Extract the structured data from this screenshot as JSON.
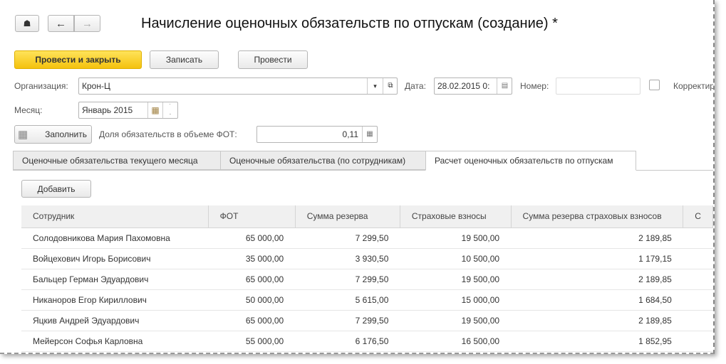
{
  "title": "Начисление оценочных обязательств по отпускам (создание) *",
  "toolbar": {
    "post_close": "Провести и закрыть",
    "save": "Записать",
    "post": "Провести"
  },
  "form": {
    "org_label": "Организация:",
    "org_value": "Крон-Ц",
    "date_label": "Дата:",
    "date_value": "28.02.2015  0:",
    "number_label": "Номер:",
    "number_value": "",
    "correct_label": "Корректир",
    "month_label": "Месяц:",
    "month_value": "Январь 2015",
    "fill_button": "Заполнить",
    "share_label": "Доля обязательств в объеме ФОТ:",
    "share_value": "0,11"
  },
  "tabs": [
    "Оценочные обязательства текущего месяца",
    "Оценочные обязательства (по сотрудникам)",
    "Расчет оценочных обязательств по отпускам"
  ],
  "add_button": "Добавить",
  "table": {
    "headers": [
      "Сотрудник",
      "ФОТ",
      "Сумма резерва",
      "Страховые взносы",
      "Сумма резерва страховых взносов",
      "С"
    ],
    "rows": [
      [
        "Солодовникова Мария Пахомовна",
        "65 000,00",
        "7 299,50",
        "19 500,00",
        "2 189,85"
      ],
      [
        "Войцехович Игорь Борисович",
        "35 000,00",
        "3 930,50",
        "10 500,00",
        "1 179,15"
      ],
      [
        "Бальцер Герман Эдуардович",
        "65 000,00",
        "7 299,50",
        "19 500,00",
        "2 189,85"
      ],
      [
        "Никаноров Егор Кириллович",
        "50 000,00",
        "5 615,00",
        "15 000,00",
        "1 684,50"
      ],
      [
        "Яцкив Андрей Эдуардович",
        "65 000,00",
        "7 299,50",
        "19 500,00",
        "2 189,85"
      ],
      [
        "Мейерсон Софья Карловна",
        "55 000,00",
        "6 176,50",
        "16 500,00",
        "1 852,95"
      ]
    ]
  }
}
